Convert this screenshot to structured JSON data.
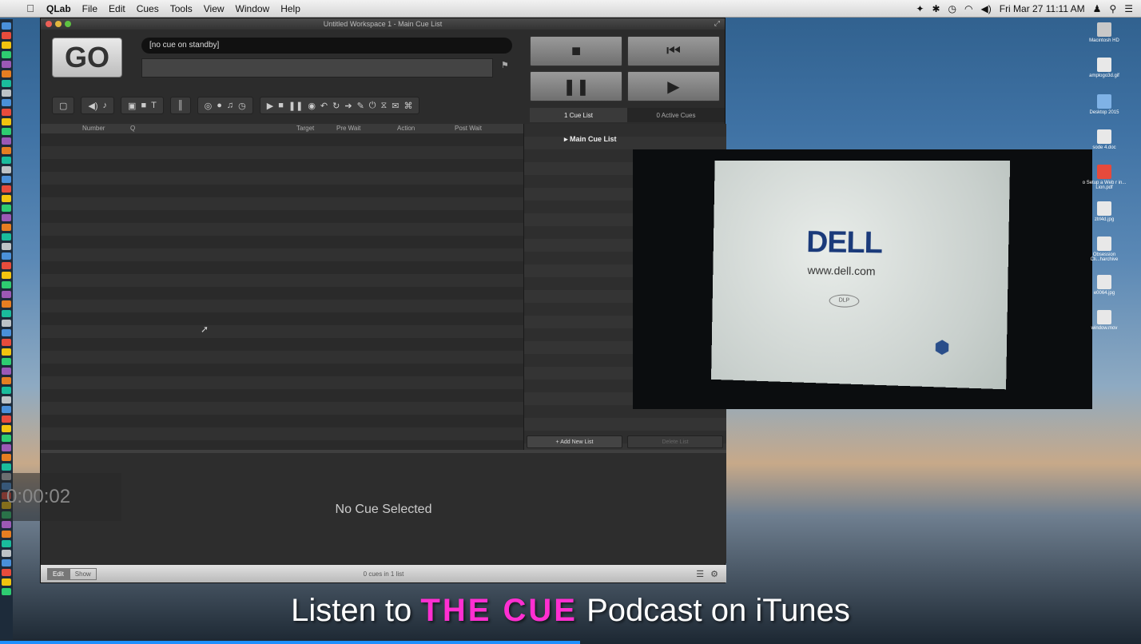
{
  "menubar": {
    "apple": "",
    "items": [
      "QLab",
      "File",
      "Edit",
      "Cues",
      "Tools",
      "View",
      "Window",
      "Help"
    ],
    "clock": "Fri Mar 27  11:11 AM"
  },
  "window": {
    "title": "Untitled Workspace 1 - Main Cue List",
    "go_label": "GO",
    "standby_text": "[no cue on standby]",
    "tabs": {
      "cue_list": "1 Cue List",
      "active_cues": "0 Active Cues"
    },
    "columns": {
      "number": "Number",
      "q": "Q",
      "target": "Target",
      "pre_wait": "Pre Wait",
      "action": "Action",
      "post_wait": "Post Wait"
    },
    "main_cue_list": "Main Cue List",
    "add_new_list": "+ Add New List",
    "delete_list": "Delete List",
    "no_cue_selected": "No Cue Selected",
    "timer": "0:00:02",
    "segment": {
      "edit": "Edit",
      "show": "Show"
    },
    "cue_count": "0 cues in 1 list"
  },
  "video": {
    "logo": "DELL",
    "url": "www.dell.com",
    "dlp": "DLP"
  },
  "desktop_icons": [
    {
      "label": "Macintosh HD"
    },
    {
      "label": "amplogo3d.gif"
    },
    {
      "label": "Desktop 2015"
    },
    {
      "label": "sode 4.doc"
    },
    {
      "label": "o Setup a Web r in... Lion.pdf"
    },
    {
      "label": "ztrl4d.jpg"
    },
    {
      "label": "Obsession Cli...harchive"
    },
    {
      "label": "e0064.jpg"
    },
    {
      "label": "window.mov"
    }
  ],
  "banner": {
    "prefix": "Listen to ",
    "brand": "THE CUE",
    "suffix": " Podcast on iTunes"
  },
  "colors": {
    "brand": "#ff2fd1",
    "progress": "#1e8fff"
  }
}
